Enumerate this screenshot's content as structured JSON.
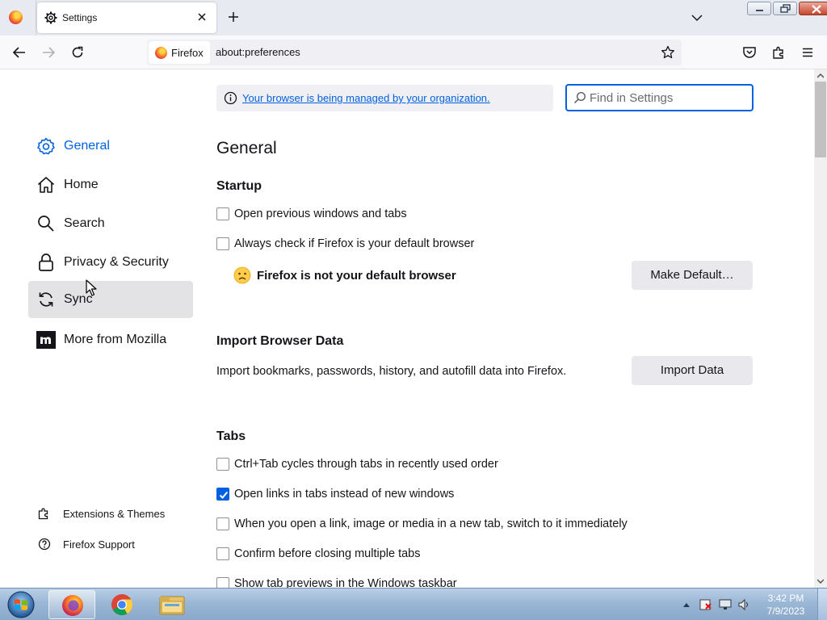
{
  "tab": {
    "title": "Settings"
  },
  "urlbar": {
    "identity_label": "Firefox",
    "url": "about:preferences"
  },
  "sidebar": {
    "items": [
      {
        "label": "General",
        "icon": "gear-icon",
        "selected": true
      },
      {
        "label": "Home",
        "icon": "home-icon"
      },
      {
        "label": "Search",
        "icon": "search-icon"
      },
      {
        "label": "Privacy & Security",
        "icon": "lock-icon"
      },
      {
        "label": "Sync",
        "icon": "sync-icon",
        "hovered": true
      },
      {
        "label": "More from Mozilla",
        "icon": "mozilla-logo-icon"
      }
    ],
    "footer": [
      {
        "label": "Extensions & Themes",
        "icon": "puzzle-icon"
      },
      {
        "label": "Firefox Support",
        "icon": "help-icon"
      }
    ]
  },
  "policy": {
    "text": "Your browser is being managed by your organization."
  },
  "search": {
    "placeholder": "Find in Settings"
  },
  "main": {
    "title": "General",
    "startup": {
      "heading": "Startup",
      "open_previous": {
        "label": "Open previous windows and tabs",
        "checked": false
      },
      "always_check": {
        "label": "Always check if Firefox is your default browser",
        "checked": false
      },
      "not_default": "Firefox is not your default browser",
      "make_default": "Make Default…"
    },
    "import": {
      "heading": "Import Browser Data",
      "description": "Import bookmarks, passwords, history, and autofill data into Firefox.",
      "button": "Import Data"
    },
    "tabs": {
      "heading": "Tabs",
      "options": [
        {
          "label": "Ctrl+Tab cycles through tabs in recently used order",
          "checked": false
        },
        {
          "label": "Open links in tabs instead of new windows",
          "checked": true
        },
        {
          "label": "When you open a link, image or media in a new tab, switch to it immediately",
          "checked": false
        },
        {
          "label": "Confirm before closing multiple tabs",
          "checked": false
        },
        {
          "label": "Show tab previews in the Windows taskbar",
          "checked": false
        }
      ]
    }
  },
  "taskbar": {
    "apps": [
      "firefox-icon",
      "chrome-icon",
      "file-explorer-icon"
    ],
    "time": "3:42 PM",
    "date": "7/9/2023"
  },
  "colors": {
    "accent": "#0061e0",
    "sidebar_hover": "#e3e3e6",
    "button_bg": "#e9e9ed"
  }
}
